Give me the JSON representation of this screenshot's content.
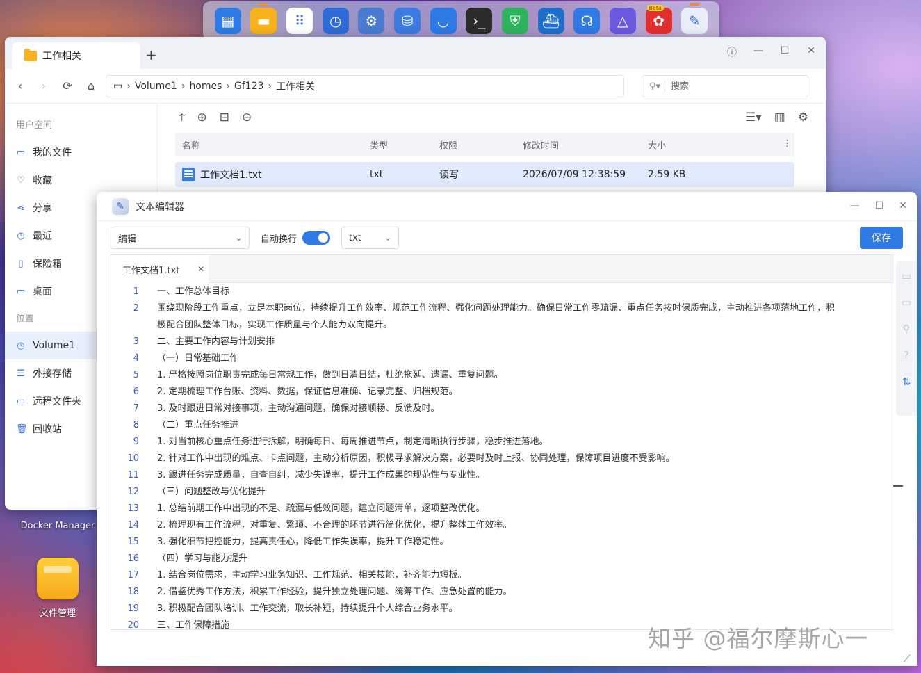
{
  "dock": {
    "icons": [
      {
        "name": "control-panel-icon",
        "color": "#2f7ae5",
        "glyph": "▦"
      },
      {
        "name": "file-manager-icon",
        "color": "#f7b21f",
        "glyph": "▬",
        "active": true
      },
      {
        "name": "app-center-icon",
        "color": "#ffffff",
        "glyph": "⠿"
      },
      {
        "name": "clock-icon",
        "color": "#2f6bd6",
        "glyph": "◷"
      },
      {
        "name": "settings-icon",
        "color": "#4a7bd0",
        "glyph": "⚙"
      },
      {
        "name": "storage-icon",
        "color": "#3e7be0",
        "glyph": "⛁"
      },
      {
        "name": "cloud-icon",
        "color": "#2f7ae5",
        "glyph": "◡"
      },
      {
        "name": "terminal-icon",
        "color": "#2b2b2b",
        "glyph": "›_"
      },
      {
        "name": "security-icon",
        "color": "#2fb35e",
        "glyph": "⛨"
      },
      {
        "name": "docker-icon",
        "color": "#1f6fc9",
        "glyph": "⛴"
      },
      {
        "name": "support-icon",
        "color": "#2f7ae5",
        "glyph": "☊"
      },
      {
        "name": "media-icon",
        "color": "#6a5ae0",
        "glyph": "△"
      },
      {
        "name": "beta-app-icon",
        "color": "#e0302f",
        "glyph": "✿",
        "beta": "Beta"
      },
      {
        "name": "text-editor-icon",
        "color": "#e9eef8",
        "glyph": "✎",
        "active": true
      }
    ]
  },
  "desktop": {
    "docker_label": "Docker Manager",
    "file_manager_label": "文件管理"
  },
  "file_manager": {
    "tab_title": "工作相关",
    "breadcrumb": [
      "Volume1",
      "homes",
      "Gf123",
      "工作相关"
    ],
    "search_placeholder": "搜索",
    "sidebar": {
      "group_user": "用户空间",
      "user_items": [
        {
          "label": "我的文件",
          "icon": "▭"
        },
        {
          "label": "收藏",
          "icon": "♡"
        },
        {
          "label": "分享",
          "icon": "⋖"
        },
        {
          "label": "最近",
          "icon": "◷"
        },
        {
          "label": "保险箱",
          "icon": "▯"
        },
        {
          "label": "桌面",
          "icon": "▭"
        }
      ],
      "group_location": "位置",
      "location_items": [
        {
          "label": "Volume1",
          "icon": "◷",
          "active": true
        },
        {
          "label": "外接存储",
          "icon": "☰"
        },
        {
          "label": "远程文件夹",
          "icon": "▭"
        },
        {
          "label": "回收站",
          "icon": "🗑"
        }
      ]
    },
    "columns": {
      "name": "名称",
      "type": "类型",
      "perm": "权限",
      "time": "修改时间",
      "size": "大小"
    },
    "rows": [
      {
        "name": "工作文档1.txt",
        "type": "txt",
        "perm": "读写",
        "time": "2026/07/09 12:38:59",
        "size": "2.59 KB"
      }
    ]
  },
  "editor": {
    "title": "文本编辑器",
    "mode_value": "编辑",
    "wrap_label": "自动换行",
    "wrap_on": true,
    "ext_value": "txt",
    "save_label": "保存",
    "tab_label": "工作文档1.txt",
    "lines": [
      {
        "n": "1",
        "t": "一、工作总体目标"
      },
      {
        "n": "2",
        "t": "围绕现阶段工作重点，立足本职岗位，持续提升工作效率、规范工作流程、强化问题处理能力。确保日常工作零疏漏、重点任务按时保质完成，主动推进各项落地工作，积"
      },
      {
        "n": "",
        "t": "极配合团队整体目标，实现工作质量与个人能力双向提升。"
      },
      {
        "n": "3",
        "t": "二、主要工作内容与计划安排"
      },
      {
        "n": "4",
        "t": "（一）日常基础工作"
      },
      {
        "n": "5",
        "t": "1. 严格按照岗位职责完成每日常规工作，做到日清日结，杜绝拖延、遗漏、重复问题。"
      },
      {
        "n": "6",
        "t": "2. 定期梳理工作台账、资料、数据，保证信息准确、记录完整、归档规范。"
      },
      {
        "n": "7",
        "t": "3. 及时跟进日常对接事项，主动沟通问题，确保对接顺畅、反馈及时。"
      },
      {
        "n": "8",
        "t": "（二）重点任务推进"
      },
      {
        "n": "9",
        "t": "1. 对当前核心重点任务进行拆解，明确每日、每周推进节点，制定清晰执行步骤，稳步推进落地。"
      },
      {
        "n": "10",
        "t": "2. 针对工作中出现的难点、卡点问题，主动分析原因，积极寻求解决方案，必要时及时上报、协同处理，保障项目进度不受影响。"
      },
      {
        "n": "11",
        "t": "3. 跟进任务完成质量，自查自纠，减少失误率，提升工作成果的规范性与专业性。"
      },
      {
        "n": "12",
        "t": "（三）问题整改与优化提升"
      },
      {
        "n": "13",
        "t": "1. 总结前期工作中出现的不足、疏漏与低效问题，建立问题清单，逐项整改优化。"
      },
      {
        "n": "14",
        "t": "2. 梳理现有工作流程，对重复、繁琐、不合理的环节进行简化优化，提升整体工作效率。"
      },
      {
        "n": "15",
        "t": "3. 强化细节把控能力，提高责任心，降低工作失误率，提升工作稳定性。"
      },
      {
        "n": "16",
        "t": "（四）学习与能力提升"
      },
      {
        "n": "17",
        "t": "1. 结合岗位需求，主动学习业务知识、工作规范、相关技能，补齐能力短板。"
      },
      {
        "n": "18",
        "t": "2. 借鉴优秀工作方法，积累工作经验，提升独立处理问题、统筹工作、应急处置的能力。"
      },
      {
        "n": "19",
        "t": "3. 积极配合团队培训、工作交流，取长补短，持续提升个人综合业务水平。"
      },
      {
        "n": "20",
        "t": "三、工作保障措施"
      }
    ]
  },
  "watermark": "知乎 @福尔摩斯心一"
}
